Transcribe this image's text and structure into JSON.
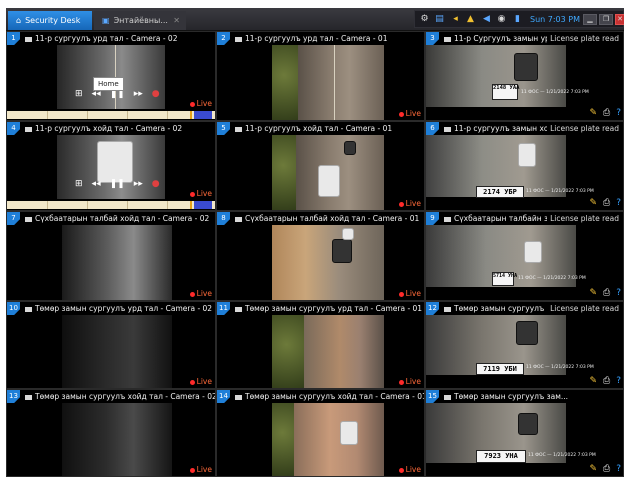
{
  "header": {
    "tabs": [
      {
        "label": "Security Desk",
        "icon": "home-icon"
      },
      {
        "label": "Энтайёвны...",
        "icon": "monitor-icon"
      }
    ],
    "clock": "Sun 7:03 PM"
  },
  "tooltip": "Home",
  "live_label": "Live",
  "lpr_label": "License plate read",
  "tiles": [
    {
      "num": "1",
      "title": "11-р сургуулъ урд тал - Camera - 02"
    },
    {
      "num": "2",
      "title": "11-р сургуулъ урд тал - Camera - 01"
    },
    {
      "num": "3",
      "title": "11-р Сургуулъ замын урд тал"
    },
    {
      "num": "4",
      "title": "11-р сургуулъ хойд тал - Camera - 02"
    },
    {
      "num": "5",
      "title": "11-р сургуулъ хойд тал - Camera - 01"
    },
    {
      "num": "6",
      "title": "11-р сургуулъ замын хойд тал"
    },
    {
      "num": "7",
      "title": "Сүхбаатарын талбай хойд тал - Camera - 02"
    },
    {
      "num": "8",
      "title": "Сүхбаатарын талбай хойд тал - Camera - 01"
    },
    {
      "num": "9",
      "title": "Сүхбаатарын талбайн замын хо..."
    },
    {
      "num": "10",
      "title": "Төмөр замын сургуулъ урд тал - Camera - 02"
    },
    {
      "num": "11",
      "title": "Төмөр замын сургуулъ урд тал - Camera - 01"
    },
    {
      "num": "12",
      "title": "Төмөр замын сургуулъ зам..."
    },
    {
      "num": "13",
      "title": "Төмөр замын сургуулъ хойд тал - Camera - 02"
    },
    {
      "num": "14",
      "title": "Төмөр замын сургуулъ хойд тал - Camera - 01"
    },
    {
      "num": "15",
      "title": "Төмөр замын сургуулъ зам..."
    }
  ],
  "plates": [
    {
      "text": "2148 УАА",
      "meta": "11 ФОС — 1/21/2022 7:03 PM"
    },
    {
      "text": "2174 УБР",
      "meta": "11 ФОС — 1/21/2022 7:03 PM"
    },
    {
      "text": "5714 УНА",
      "meta": "11 ФОС — 1/21/2022 7:03 PM"
    },
    {
      "text": "7119 УБИ",
      "meta": "11 ФОС — 1/21/2022 7:03 PM"
    },
    {
      "text": "7923 УНА",
      "meta": "11 ФОС — 1/21/2022 7:03 PM"
    }
  ]
}
